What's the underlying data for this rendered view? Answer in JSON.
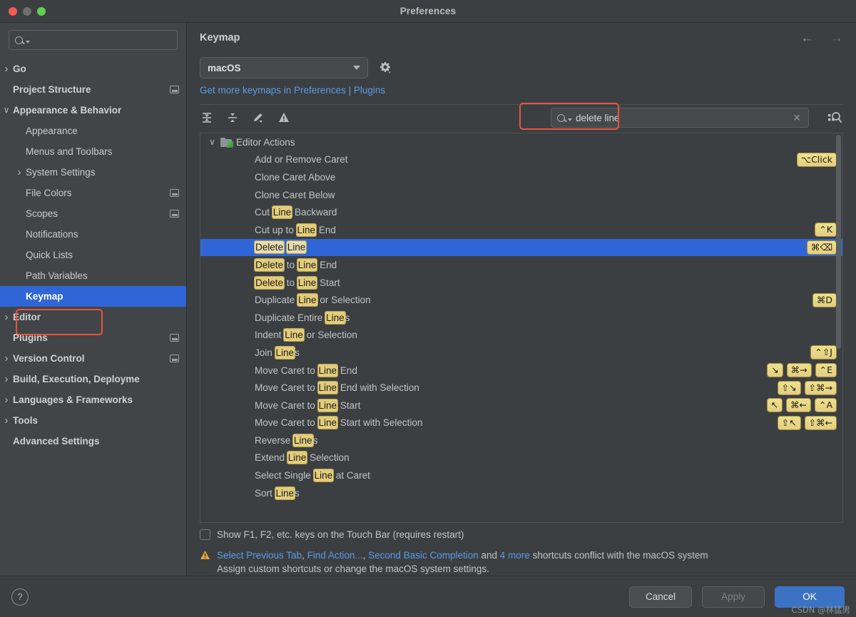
{
  "window": {
    "title": "Preferences",
    "traffic_lights": [
      "close",
      "minimize",
      "zoom"
    ]
  },
  "sidebar": {
    "search": {
      "value": "",
      "placeholder": ""
    },
    "items": [
      {
        "label": "Go",
        "level": 1,
        "bold": true,
        "arrow": "right",
        "badge": false
      },
      {
        "label": "Project Structure",
        "level": 1,
        "bold": true,
        "arrow": "none",
        "badge": true
      },
      {
        "label": "Appearance & Behavior",
        "level": 1,
        "bold": true,
        "arrow": "down",
        "badge": false
      },
      {
        "label": "Appearance",
        "level": 2,
        "bold": false,
        "arrow": "none",
        "badge": false
      },
      {
        "label": "Menus and Toolbars",
        "level": 2,
        "bold": false,
        "arrow": "none",
        "badge": false
      },
      {
        "label": "System Settings",
        "level": 2,
        "bold": false,
        "arrow": "right",
        "badge": false
      },
      {
        "label": "File Colors",
        "level": 2,
        "bold": false,
        "arrow": "none",
        "badge": true
      },
      {
        "label": "Scopes",
        "level": 2,
        "bold": false,
        "arrow": "none",
        "badge": true
      },
      {
        "label": "Notifications",
        "level": 2,
        "bold": false,
        "arrow": "none",
        "badge": false
      },
      {
        "label": "Quick Lists",
        "level": 2,
        "bold": false,
        "arrow": "none",
        "badge": false
      },
      {
        "label": "Path Variables",
        "level": 2,
        "bold": false,
        "arrow": "none",
        "badge": false
      },
      {
        "label": "Keymap",
        "level": 2,
        "bold": true,
        "arrow": "none",
        "badge": false,
        "selected": true,
        "highlighted": true
      },
      {
        "label": "Editor",
        "level": 1,
        "bold": true,
        "arrow": "right",
        "badge": false
      },
      {
        "label": "Plugins",
        "level": 1,
        "bold": true,
        "arrow": "none",
        "badge": true
      },
      {
        "label": "Version Control",
        "level": 1,
        "bold": true,
        "arrow": "right",
        "badge": true
      },
      {
        "label": "Build, Execution, Deployme",
        "level": 1,
        "bold": true,
        "arrow": "right",
        "badge": false
      },
      {
        "label": "Languages & Frameworks",
        "level": 1,
        "bold": true,
        "arrow": "right",
        "badge": false
      },
      {
        "label": "Tools",
        "level": 1,
        "bold": true,
        "arrow": "right",
        "badge": false
      },
      {
        "label": "Advanced Settings",
        "level": 1,
        "bold": true,
        "arrow": "none",
        "badge": false
      }
    ]
  },
  "main": {
    "page_title": "Keymap",
    "keymap_select": {
      "value": "macOS"
    },
    "plugins_link": "Get more keymaps in Preferences | Plugins",
    "toolbar_icons": [
      "expand-all-icon",
      "collapse-all-icon",
      "edit-shortcut-icon",
      "conflicts-icon"
    ],
    "find": {
      "value": "delete line",
      "placeholder": ""
    },
    "touchbar_checkbox": {
      "label": "Show F1, F2, etc. keys on the Touch Bar (requires restart)",
      "checked": false
    },
    "warning": {
      "link1": "Select Previous Tab",
      "sep1": ", ",
      "link2": "Find Action...",
      "sep2": ", ",
      "link3": "Second Basic Completion",
      "mid": " and ",
      "link4": "4 more",
      "tail": " shortcuts conflict with the macOS system",
      "line2": "Assign custom shortcuts or change the macOS system settings."
    }
  },
  "actions": {
    "group": {
      "label": "Editor Actions",
      "expanded": true
    },
    "rows": [
      {
        "parts": [
          {
            "t": "Add or Remove Caret",
            "h": false
          }
        ],
        "keys": [
          "⌥Click"
        ]
      },
      {
        "parts": [
          {
            "t": "Clone Caret Above",
            "h": false
          }
        ],
        "keys": []
      },
      {
        "parts": [
          {
            "t": "Clone Caret Below",
            "h": false
          }
        ],
        "keys": []
      },
      {
        "parts": [
          {
            "t": "Cut ",
            "h": false
          },
          {
            "t": "Line",
            "h": true
          },
          {
            "t": " Backward",
            "h": false
          }
        ],
        "keys": []
      },
      {
        "parts": [
          {
            "t": "Cut up to ",
            "h": false
          },
          {
            "t": "Line",
            "h": true
          },
          {
            "t": " End",
            "h": false
          }
        ],
        "keys": [
          "⌃K"
        ]
      },
      {
        "parts": [
          {
            "t": "Delete",
            "h": true
          },
          {
            "t": " ",
            "h": false
          },
          {
            "t": "Line",
            "h": true
          }
        ],
        "keys": [
          "⌘⌫"
        ],
        "selected": true
      },
      {
        "parts": [
          {
            "t": "Delete",
            "h": true
          },
          {
            "t": " to ",
            "h": false
          },
          {
            "t": "Line",
            "h": true
          },
          {
            "t": " End",
            "h": false
          }
        ],
        "keys": []
      },
      {
        "parts": [
          {
            "t": "Delete",
            "h": true
          },
          {
            "t": " to ",
            "h": false
          },
          {
            "t": "Line",
            "h": true
          },
          {
            "t": " Start",
            "h": false
          }
        ],
        "keys": []
      },
      {
        "parts": [
          {
            "t": "Duplicate ",
            "h": false
          },
          {
            "t": "Line",
            "h": true
          },
          {
            "t": " or Selection",
            "h": false
          }
        ],
        "keys": [
          "⌘D"
        ]
      },
      {
        "parts": [
          {
            "t": "Duplicate Entire ",
            "h": false
          },
          {
            "t": "Line",
            "h": true
          },
          {
            "t": "s",
            "h": false
          }
        ],
        "keys": []
      },
      {
        "parts": [
          {
            "t": "Indent ",
            "h": false
          },
          {
            "t": "Line",
            "h": true
          },
          {
            "t": " or Selection",
            "h": false
          }
        ],
        "keys": []
      },
      {
        "parts": [
          {
            "t": "Join ",
            "h": false
          },
          {
            "t": "Line",
            "h": true
          },
          {
            "t": "s",
            "h": false
          }
        ],
        "keys": [
          "⌃⇧J"
        ]
      },
      {
        "parts": [
          {
            "t": "Move Caret to ",
            "h": false
          },
          {
            "t": "Line",
            "h": true
          },
          {
            "t": " End",
            "h": false
          }
        ],
        "keys": [
          "↘",
          "⌘→",
          "⌃E"
        ]
      },
      {
        "parts": [
          {
            "t": "Move Caret to ",
            "h": false
          },
          {
            "t": "Line",
            "h": true
          },
          {
            "t": " End with Selection",
            "h": false
          }
        ],
        "keys": [
          "⇧↘",
          "⇧⌘→"
        ]
      },
      {
        "parts": [
          {
            "t": "Move Caret to ",
            "h": false
          },
          {
            "t": "Line",
            "h": true
          },
          {
            "t": " Start",
            "h": false
          }
        ],
        "keys": [
          "↖",
          "⌘←",
          "⌃A"
        ]
      },
      {
        "parts": [
          {
            "t": "Move Caret to ",
            "h": false
          },
          {
            "t": "Line",
            "h": true
          },
          {
            "t": " Start with Selection",
            "h": false
          }
        ],
        "keys": [
          "⇧↖",
          "⇧⌘←"
        ]
      },
      {
        "parts": [
          {
            "t": "Reverse ",
            "h": false
          },
          {
            "t": "Line",
            "h": true
          },
          {
            "t": "s",
            "h": false
          }
        ],
        "keys": []
      },
      {
        "parts": [
          {
            "t": "Extend ",
            "h": false
          },
          {
            "t": "Line",
            "h": true
          },
          {
            "t": " Selection",
            "h": false
          }
        ],
        "keys": []
      },
      {
        "parts": [
          {
            "t": "Select Single ",
            "h": false
          },
          {
            "t": "Line",
            "h": true
          },
          {
            "t": " at Caret",
            "h": false
          }
        ],
        "keys": []
      },
      {
        "parts": [
          {
            "t": "Sort ",
            "h": false
          },
          {
            "t": "Line",
            "h": true
          },
          {
            "t": "s",
            "h": false
          }
        ],
        "keys": []
      }
    ]
  },
  "footer": {
    "help": "?",
    "cancel": "Cancel",
    "apply": "Apply",
    "ok": "OK"
  },
  "watermark": "CSDN @林猛男",
  "colors": {
    "accent_selection": "#2f65d6",
    "highlight_marker": "#e3cd7b",
    "link": "#5a9ae6",
    "annotation_box": "#e8563a",
    "primary_button": "#3b72c4"
  }
}
